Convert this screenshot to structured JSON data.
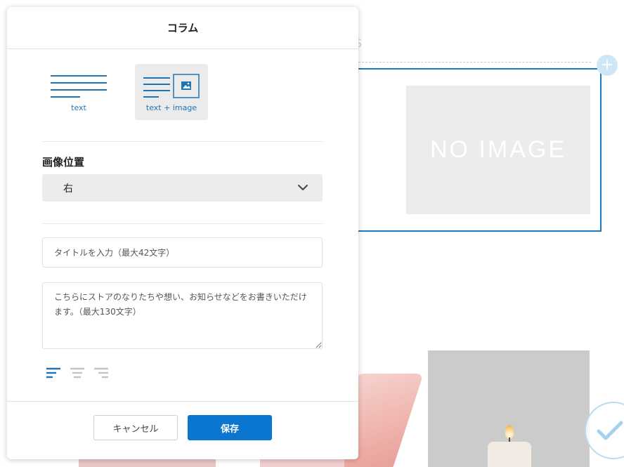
{
  "modal": {
    "title": "コラム",
    "layouts": [
      {
        "label": "text",
        "icon": "text-layout-icon",
        "selected": false
      },
      {
        "label": "text + image",
        "icon": "text-image-layout-icon",
        "selected": true
      }
    ],
    "image_position": {
      "label": "画像位置",
      "selected": "右"
    },
    "title_field": {
      "placeholder": "タイトルを入力（最大42文字）",
      "value": ""
    },
    "body_field": {
      "placeholder": "こちらにストアのなりたちや想い、お知らせなどをお書きいただけます。（最大130文字）",
      "value": ""
    },
    "align_buttons": [
      {
        "icon": "align-left-icon",
        "active": true
      },
      {
        "icon": "align-center-icon",
        "active": false
      },
      {
        "icon": "align-right-icon",
        "active": false
      }
    ],
    "cancel_label": "キャンセル",
    "save_label": "保存"
  },
  "background": {
    "faded_letter": "S",
    "noimage_text": "NO IMAGE",
    "add_icon": "plus-icon",
    "confirm_icon": "check-icon"
  },
  "colors": {
    "accent": "#0b76cf",
    "link": "#1f74b5",
    "frame": "#1f78b8",
    "muted": "#c4c4c4"
  }
}
